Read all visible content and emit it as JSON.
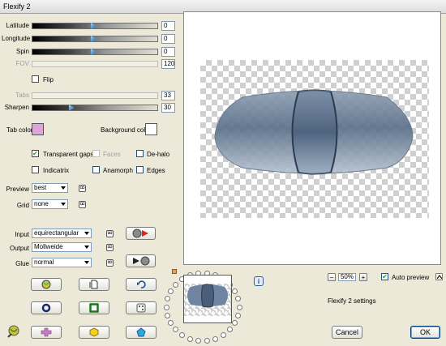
{
  "window": {
    "title": "Flexify 2"
  },
  "sliders": [
    {
      "label": "Latitude",
      "value": "0",
      "disabled": false,
      "level": 0.45
    },
    {
      "label": "Longitude",
      "value": "0",
      "disabled": false,
      "level": 0.45
    },
    {
      "label": "Spin",
      "value": "0",
      "disabled": false,
      "level": 0.45
    },
    {
      "label": "FOV",
      "value": "120",
      "disabled": true
    },
    {
      "label": "Tabs",
      "value": "33",
      "disabled": true
    },
    {
      "label": "Sharpen",
      "value": "30",
      "disabled": false,
      "level": 0.28
    }
  ],
  "flip": {
    "label": "Flip",
    "checked": false
  },
  "colors": {
    "tab_color_label": "Tab color",
    "tab_color": "#d9a7d9",
    "background_color_label": "Background color",
    "background_color": "#ffffff"
  },
  "options": {
    "transparent_gaps": "Transparent gaps",
    "faces": "Faces",
    "de_halo": "De-halo",
    "indicatrix": "Indicatrix",
    "anamorph": "Anamorph",
    "edges": "Edges"
  },
  "preview_select": {
    "label": "Preview",
    "value": "best"
  },
  "grid_select": {
    "label": "Grid",
    "value": "none"
  },
  "input_select": {
    "label": "Input",
    "value": "equirectangular"
  },
  "output_select": {
    "label": "Output",
    "value": "Mollweide"
  },
  "glue_select": {
    "label": "Glue",
    "value": "normal"
  },
  "link_glyph": "ꝏ",
  "zoom": {
    "value": "50%",
    "minus": "−",
    "plus": "+"
  },
  "auto_preview": {
    "label": "Auto preview",
    "checked": true
  },
  "info_glyph": "i",
  "settings_text": "Flexify 2 settings",
  "cancel_label": "Cancel",
  "ok_label": "OK",
  "accent": "#316ac5"
}
